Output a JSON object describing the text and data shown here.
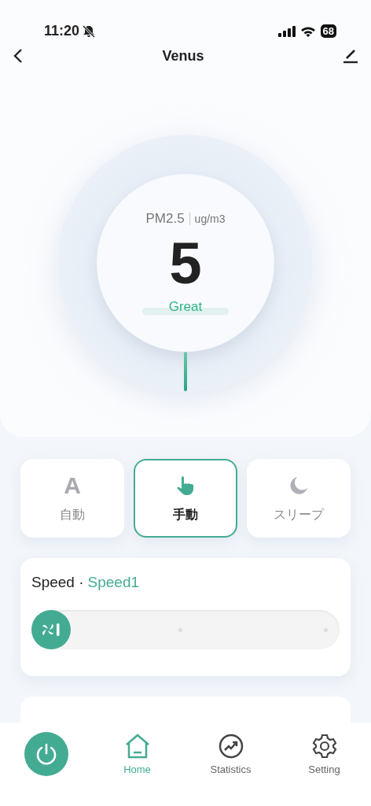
{
  "status_bar": {
    "time": "11:20",
    "battery": "68"
  },
  "nav_bar": {
    "title": "Venus"
  },
  "air_quality": {
    "pollutant": "PM2.5",
    "unit": "ug/m3",
    "value": "5",
    "rating": "Great"
  },
  "modes": [
    {
      "kind": "letter",
      "glyph": "A",
      "label": "自動",
      "selected": false
    },
    {
      "kind": "hand",
      "label": "手動",
      "selected": true
    },
    {
      "kind": "moon",
      "label": "スリープ",
      "selected": false
    }
  ],
  "speed": {
    "label": "Speed ·",
    "value": "Speed1",
    "level": 0
  },
  "tab_bar": {
    "tabs": [
      {
        "kind": "home",
        "label": "Home",
        "selected": true
      },
      {
        "kind": "stats",
        "label": "Statistics",
        "selected": false
      },
      {
        "kind": "gear",
        "label": "Setting",
        "selected": false
      }
    ]
  }
}
